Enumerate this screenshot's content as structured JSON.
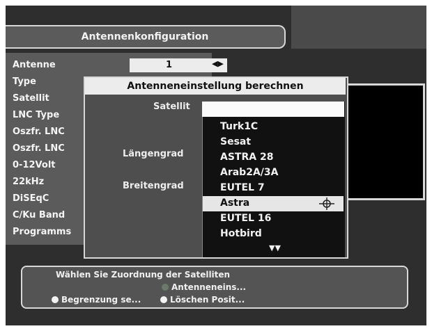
{
  "header": {
    "title": "Antennenkonfiguration"
  },
  "settings": {
    "labels": [
      "Antenne",
      "Type",
      "Satellit",
      "LNC Type",
      "Oszfr. LNC",
      "Oszfr. LNC",
      "0-12Volt",
      "22kHz",
      "DiSEqC",
      "C/Ku Band",
      "Programms"
    ],
    "antenne_value": "1",
    "antenne_arrows": "◀▶"
  },
  "dialog": {
    "title": "Antenneneinstellung berechnen",
    "satellit_label": "Satellit",
    "laengengrad_label": "Längengrad",
    "breitengrad_label": "Breitengrad",
    "satellit_value": ""
  },
  "dropdown": {
    "options": [
      "Turk1C",
      "Sesat",
      "ASTRA 28",
      "Arab2A/3A",
      "EUTEL 7",
      "Astra",
      "EUTEL 16",
      "Hotbird"
    ],
    "selected": "Astra",
    "more_indicator": "▼▼"
  },
  "help": {
    "line1": "Wählen Sie Zuordnung der Satelliten",
    "green_label": "Antenneneins...",
    "yellow_label": "Begrenzung se...",
    "white_label": "Löschen Posit..."
  },
  "colors": {
    "panel": "#5b5b5b",
    "background": "#2e2e2e",
    "highlight": "#ececec",
    "green_key": "#6b7a6b"
  }
}
